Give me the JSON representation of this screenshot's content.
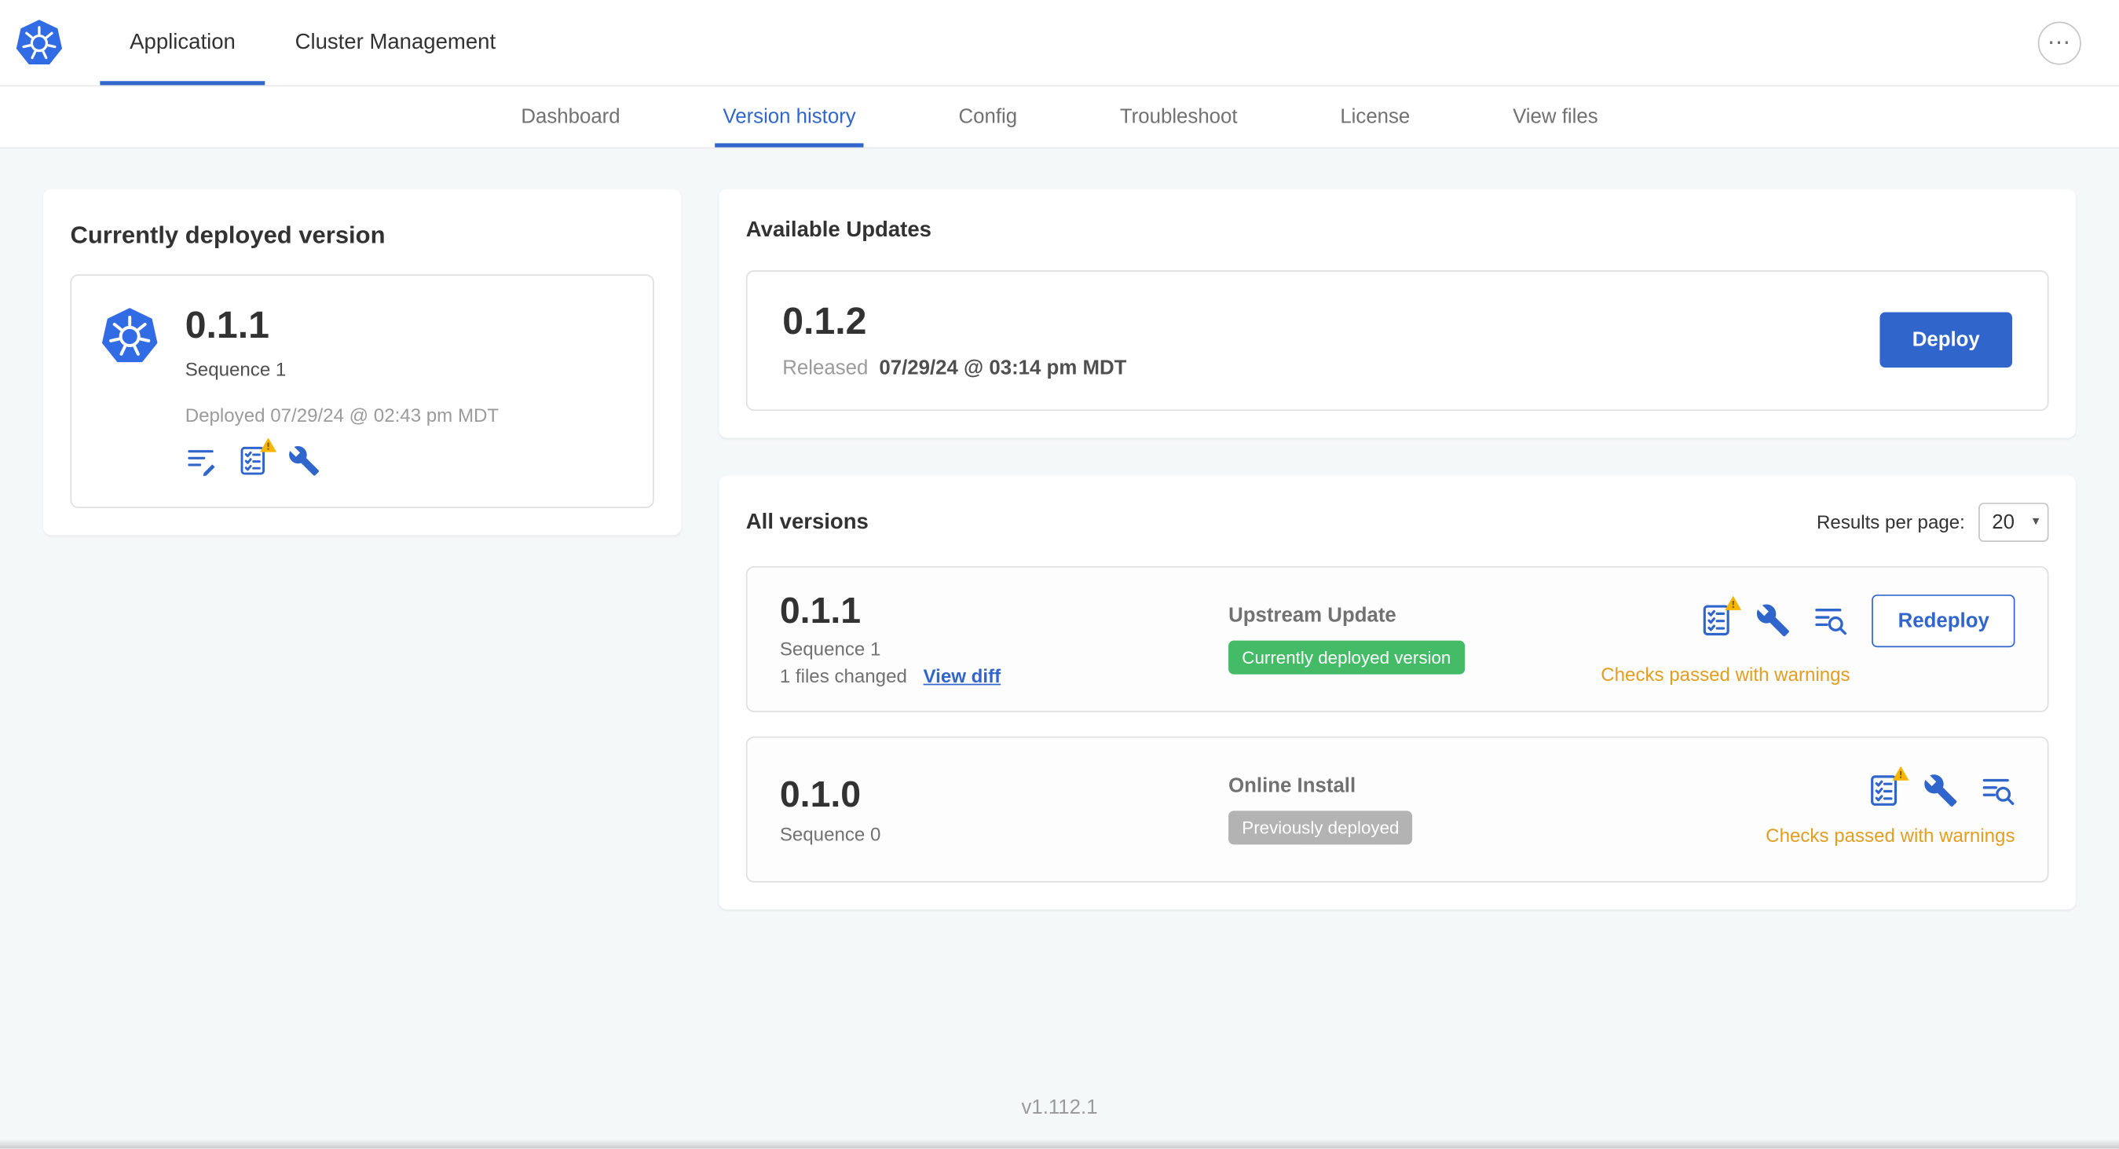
{
  "colors": {
    "primary_blue": "#3066cb",
    "k8s_blue": "#326ce5",
    "warning_orange": "#e29e20",
    "success_green": "#44bb66",
    "muted_gray": "#b3b3b3"
  },
  "icons": {
    "ellipsis_menu": "⋯",
    "chevron_down": "▾",
    "kubernetes_logo": "kubernetes-helm-wheel",
    "release_notes": "text-lines-with-pencil",
    "preflight_checks": "checklist-with-warning-triangle",
    "config": "wrench",
    "deploy_logs": "text-lines-with-magnifier"
  },
  "top_nav": {
    "tabs": [
      {
        "label": "Application"
      },
      {
        "label": "Cluster Management"
      }
    ],
    "active_tab": "Application"
  },
  "sub_nav": {
    "items": [
      {
        "label": "Dashboard"
      },
      {
        "label": "Version history"
      },
      {
        "label": "Config"
      },
      {
        "label": "Troubleshoot"
      },
      {
        "label": "License"
      },
      {
        "label": "View files"
      }
    ],
    "active_item": "Version history"
  },
  "currently_deployed": {
    "heading": "Currently deployed version",
    "version": "0.1.1",
    "sequence": "Sequence 1",
    "deployed_timestamp": "Deployed 07/29/24 @ 02:43 pm MDT"
  },
  "available_updates": {
    "heading": "Available Updates",
    "update": {
      "version": "0.1.2",
      "released_label": "Released",
      "released_timestamp": "07/29/24 @ 03:14 pm MDT",
      "deploy_button": "Deploy"
    }
  },
  "all_versions": {
    "heading": "All versions",
    "results_per_page_label": "Results per page:",
    "results_per_page_value": "20",
    "rows": [
      {
        "version": "0.1.1",
        "sequence": "Sequence 1",
        "files_changed": "1 files changed",
        "view_diff_link": "View diff",
        "source": "Upstream Update",
        "badge": "Currently deployed version",
        "status": "Checks passed with warnings",
        "action_button": "Redeploy"
      },
      {
        "version": "0.1.0",
        "sequence": "Sequence 0",
        "source": "Online Install",
        "badge": "Previously deployed",
        "status": "Checks passed with warnings"
      }
    ]
  },
  "footer": {
    "app_version": "v1.112.1"
  }
}
